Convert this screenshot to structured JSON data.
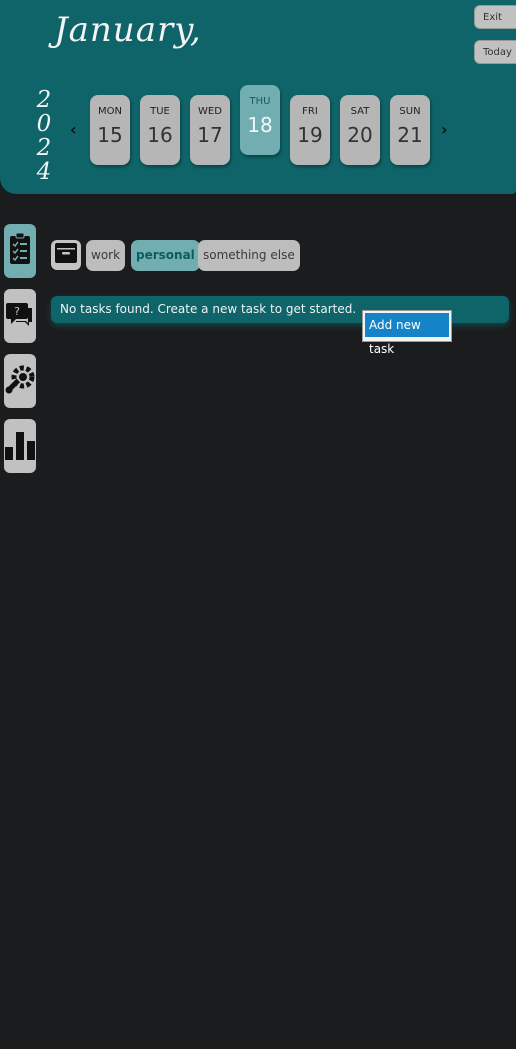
{
  "header": {
    "month": "January,",
    "year_digits": [
      "2",
      "0",
      "2",
      "4"
    ],
    "exit_label": "Exit",
    "today_label": "Today",
    "prev_icon": "chevron-left-icon",
    "next_icon": "chevron-right-icon"
  },
  "week": [
    {
      "day": "MON",
      "date": "15"
    },
    {
      "day": "TUE",
      "date": "16"
    },
    {
      "day": "WED",
      "date": "17"
    },
    {
      "day": "THU",
      "date": "18",
      "selected": true
    },
    {
      "day": "FRI",
      "date": "19"
    },
    {
      "day": "SAT",
      "date": "20"
    },
    {
      "day": "SUN",
      "date": "21"
    }
  ],
  "sidebar": {
    "items": [
      {
        "icon": "clipboard-checklist-icon",
        "active": true
      },
      {
        "icon": "chat-question-icon"
      },
      {
        "icon": "wrench-gear-icon"
      },
      {
        "icon": "bar-chart-icon"
      }
    ]
  },
  "filters": {
    "archive_icon": "archive-box-icon",
    "tags": [
      {
        "label": "work"
      },
      {
        "label": "personal",
        "active": true
      },
      {
        "label": "something else"
      }
    ]
  },
  "tasks": {
    "empty_message": "No tasks found. Create a new task to get started."
  },
  "context_menu": {
    "items": [
      {
        "label": "Add new task",
        "highlighted": true
      }
    ]
  },
  "colors": {
    "background": "#1b1c1e",
    "header": "#0e6468",
    "accent": "#72aeb1",
    "button": "#bdbdbd",
    "menu_highlight": "#1583c8"
  }
}
